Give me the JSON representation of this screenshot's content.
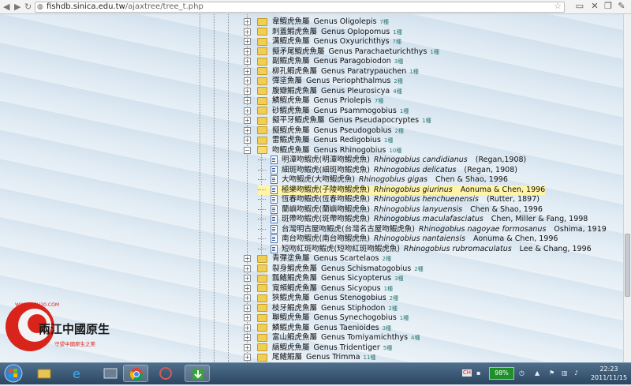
{
  "browser": {
    "url_host": "fishdb.sinica.edu.tw",
    "url_path": "/ajaxtree/tree_t.php",
    "back_icon": "back-arrow-icon",
    "forward_icon": "forward-arrow-icon"
  },
  "tree": {
    "genera_before": [
      {
        "cn": "韋鰕虎魚屬",
        "genus": "Genus Oligolepis",
        "count": "7種"
      },
      {
        "cn": "刺蓋鰕虎魚屬",
        "genus": "Genus Oplopomus",
        "count": "1種"
      },
      {
        "cn": "溝鰕虎魚屬",
        "genus": "Genus Oxyurichthys",
        "count": "7種"
      },
      {
        "cn": "擬矛尾鰕虎魚屬",
        "genus": "Genus Parachaeturichthys",
        "count": "1種"
      },
      {
        "cn": "副鰕虎魚屬",
        "genus": "Genus Paragobiodon",
        "count": "3種"
      },
      {
        "cn": "柳孔鰕虎魚屬",
        "genus": "Genus Paratrypauchen",
        "count": "1種"
      },
      {
        "cn": "彈塗魚屬",
        "genus": "Genus Periophthalmus",
        "count": "2種"
      },
      {
        "cn": "腹瓣鰕虎魚屬",
        "genus": "Genus Pleurosicya",
        "count": "4種"
      },
      {
        "cn": "鱗鰕虎魚屬",
        "genus": "Genus Priolepis",
        "count": "7種"
      },
      {
        "cn": "砂鰕虎魚屬",
        "genus": "Genus Psammogobius",
        "count": "1種"
      },
      {
        "cn": "擬平牙鰕虎魚屬",
        "genus": "Genus Pseudapocryptes",
        "count": "1種"
      },
      {
        "cn": "擬鰕虎魚屬",
        "genus": "Genus Pseudogobius",
        "count": "2種"
      },
      {
        "cn": "雷鰕虎魚屬",
        "genus": "Genus Redigobius",
        "count": "1種"
      }
    ],
    "open_genus": {
      "cn": "吻鰕虎魚屬",
      "genus": "Genus Rhinogobius",
      "count": "10種"
    },
    "species": [
      {
        "cn": "明潭吻鰕虎(明潭吻鰕虎魚)",
        "sci": "Rhinogobius candidianus",
        "auth": "(Regan,1908)"
      },
      {
        "cn": "細斑吻鰕虎(細斑吻鰕虎魚)",
        "sci": "Rhinogobius delicatus",
        "auth": "(Regan, 1908)"
      },
      {
        "cn": "大吻鰕虎(大吻鰕虎魚)",
        "sci": "Rhinogobius gigas",
        "auth": "Chen & Shao, 1996"
      },
      {
        "cn": "極樂吻鰕虎(子陵吻鰕虎魚)",
        "sci": "Rhinogobius giurinus",
        "auth": "Aonuma & Chen, 1996"
      },
      {
        "cn": "恆春吻鰕虎(恆春吻鰕虎魚)",
        "sci": "Rhinogobius henchuenensis",
        "auth": "(Rutter, 1897)"
      },
      {
        "cn": "蘭嶼吻鰕虎(蘭嶼吻鰕虎魚)",
        "sci": "Rhinogobius lanyuensis",
        "auth": "Chen & Shao, 1996"
      },
      {
        "cn": "斑帶吻鰕虎(斑帶吻鰕虎魚)",
        "sci": "Rhinogobius maculafasciatus",
        "auth": "Chen, Miller & Fang, 1998"
      },
      {
        "cn": "台灣明古屋吻鰕虎(台灣名古屋吻鰕虎魚)",
        "sci": "Rhinogobius nagoyae formosanus",
        "auth": "Oshima, 1919"
      },
      {
        "cn": "南台吻鰕虎(南台吻鰕虎魚)",
        "sci": "Rhinogobius nantaiensis",
        "auth": "Aonuma & Chen, 1996"
      },
      {
        "cn": "短吻紅斑吻鰕虎(短吻紅斑吻鰕虎魚)",
        "sci": "Rhinogobius rubromaculatus",
        "auth": "Lee & Chang, 1996"
      }
    ],
    "genera_after": [
      {
        "cn": "青彈塗魚屬",
        "genus": "Genus Scartelaos",
        "count": "2種"
      },
      {
        "cn": "裂身鰕虎魚屬",
        "genus": "Genus Schismatogobius",
        "count": "2種"
      },
      {
        "cn": "瓢鰭鰕虎魚屬",
        "genus": "Genus Sicyopterus",
        "count": "3種"
      },
      {
        "cn": "寬頰鰕虎魚屬",
        "genus": "Genus Sicyopus",
        "count": "1種"
      },
      {
        "cn": "狹鰕虎魚屬",
        "genus": "Genus Stenogobius",
        "count": "2種"
      },
      {
        "cn": "枝牙鰕虎魚屬",
        "genus": "Genus Stiphodon",
        "count": "2種"
      },
      {
        "cn": "聯鰕虎魚屬",
        "genus": "Genus Synechogobius",
        "count": "1種"
      },
      {
        "cn": "鱗鰕虎魚屬",
        "genus": "Genus Taenioides",
        "count": "3種"
      },
      {
        "cn": "富山鰕虎魚屬",
        "genus": "Genus Tomiyamichthys",
        "count": "4種"
      },
      {
        "cn": "縞鰕虎魚屬",
        "genus": "Genus Tridentiger",
        "count": "5種"
      },
      {
        "cn": "尾鰭鰕屬",
        "genus": "Genus Trimma",
        "count": "11種"
      }
    ]
  },
  "overlay_logo": {
    "url": "WWW.CGH20.COM",
    "name": "兩江中國原生",
    "slogan": "守望中國原生之美"
  },
  "taskbar": {
    "icons": [
      "windows-start-icon",
      "file-explorer-icon",
      "media-player-icon",
      "internet-explorer-icon",
      "chrome-icon",
      "app-icon",
      "download-manager-icon"
    ],
    "ime": "CH",
    "battery": "98%",
    "time": "22:23",
    "date": "2011/11/15"
  },
  "colors": {
    "highlight": "#fff4a8",
    "count_text": "#2d7a73",
    "logo_red": "#d9241c"
  }
}
